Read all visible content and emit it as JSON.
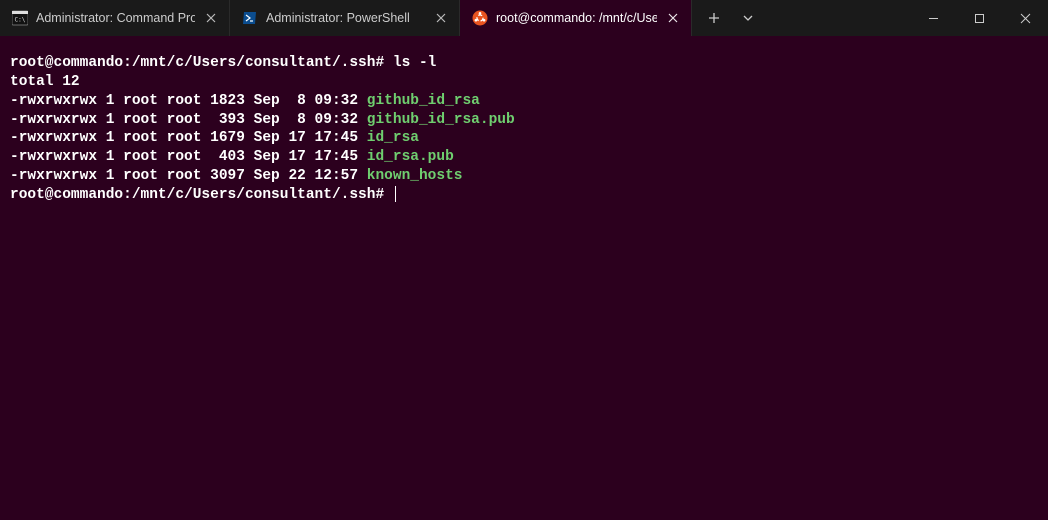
{
  "tabs": [
    {
      "label": "Administrator: Command Promp",
      "active": false,
      "icon": "cmd"
    },
    {
      "label": "Administrator: PowerShell",
      "active": false,
      "icon": "powershell"
    },
    {
      "label": "root@commando: /mnt/c/Users",
      "active": true,
      "icon": "ubuntu"
    }
  ],
  "terminal": {
    "prompt": "root@commando:/mnt/c/Users/consultant/.ssh#",
    "command": "ls -l",
    "total": "total 12",
    "listing": [
      {
        "meta": "-rwxrwxrwx 1 root root 1823 Sep  8 09:32 ",
        "name": "github_id_rsa"
      },
      {
        "meta": "-rwxrwxrwx 1 root root  393 Sep  8 09:32 ",
        "name": "github_id_rsa.pub"
      },
      {
        "meta": "-rwxrwxrwx 1 root root 1679 Sep 17 17:45 ",
        "name": "id_rsa"
      },
      {
        "meta": "-rwxrwxrwx 1 root root  403 Sep 17 17:45 ",
        "name": "id_rsa.pub"
      },
      {
        "meta": "-rwxrwxrwx 1 root root 3097 Sep 22 12:57 ",
        "name": "known_hosts"
      }
    ]
  }
}
